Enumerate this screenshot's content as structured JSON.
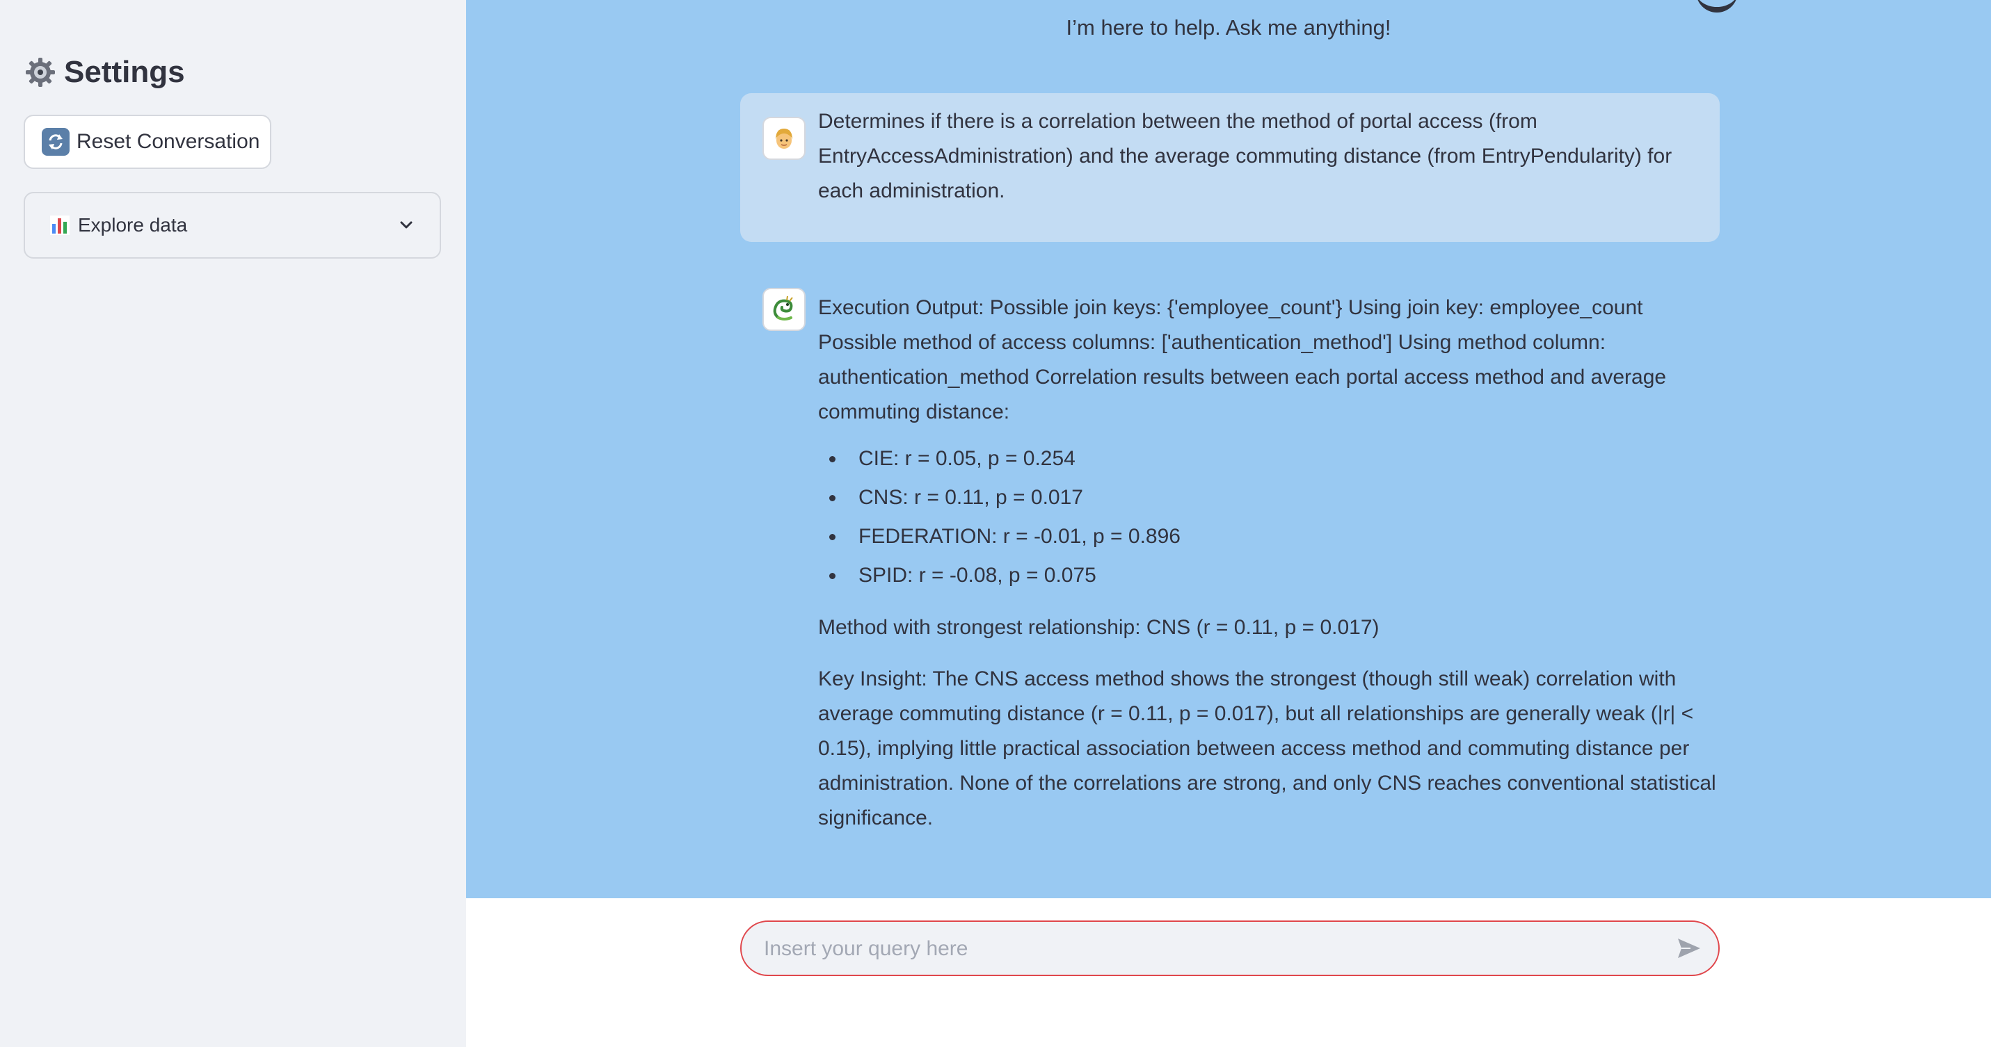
{
  "sidebar": {
    "title": "Settings",
    "reset_label": "Reset Conversation",
    "explore_label": "Explore data"
  },
  "main": {
    "subtitle": "I’m here to help. Ask me anything!"
  },
  "messages": {
    "user": {
      "text": "Determines if there is a correlation between the method of portal access (from EntryAccessAdministration) and the average commuting distance (from EntryPendularity) for each administration."
    },
    "bot": {
      "intro": "Execution Output: Possible join keys: {'employee_count'} Using join key: employee_count Possible method of access columns: ['authentication_method'] Using method column: authentication_method Correlation results between each portal access method and average commuting distance:",
      "results": [
        "CIE: r = 0.05, p = 0.254",
        "CNS: r = 0.11, p = 0.017",
        "FEDERATION: r = -0.01, p = 0.896",
        "SPID: r = -0.08, p = 0.075"
      ],
      "strongest": "Method with strongest relationship: CNS (r = 0.11, p = 0.017)",
      "insight": "Key Insight: The CNS access method shows the strongest (though still weak) correlation with average commuting distance (r = 0.11, p = 0.017), but all relationships are generally weak (|r| < 0.15), implying little practical association between access method and commuting distance per administration. None of the correlations are strong, and only CNS reaches conventional statistical significance."
    }
  },
  "input": {
    "placeholder": "Insert your query here",
    "value": ""
  },
  "icons": {
    "settings": "gear-icon",
    "reset": "refresh-icon",
    "explore": "bar-chart-icon",
    "expand": "chevron-down-icon",
    "user_avatar": "user-avatar-icon",
    "bot_avatar": "dragon-avatar-icon",
    "send": "send-icon"
  },
  "colors": {
    "sidebar_bg": "#f0f2f6",
    "chat_bg": "#99c9f2",
    "user_bubble": "#c3dcf3",
    "input_border": "#e0474c",
    "text": "#31333f"
  }
}
